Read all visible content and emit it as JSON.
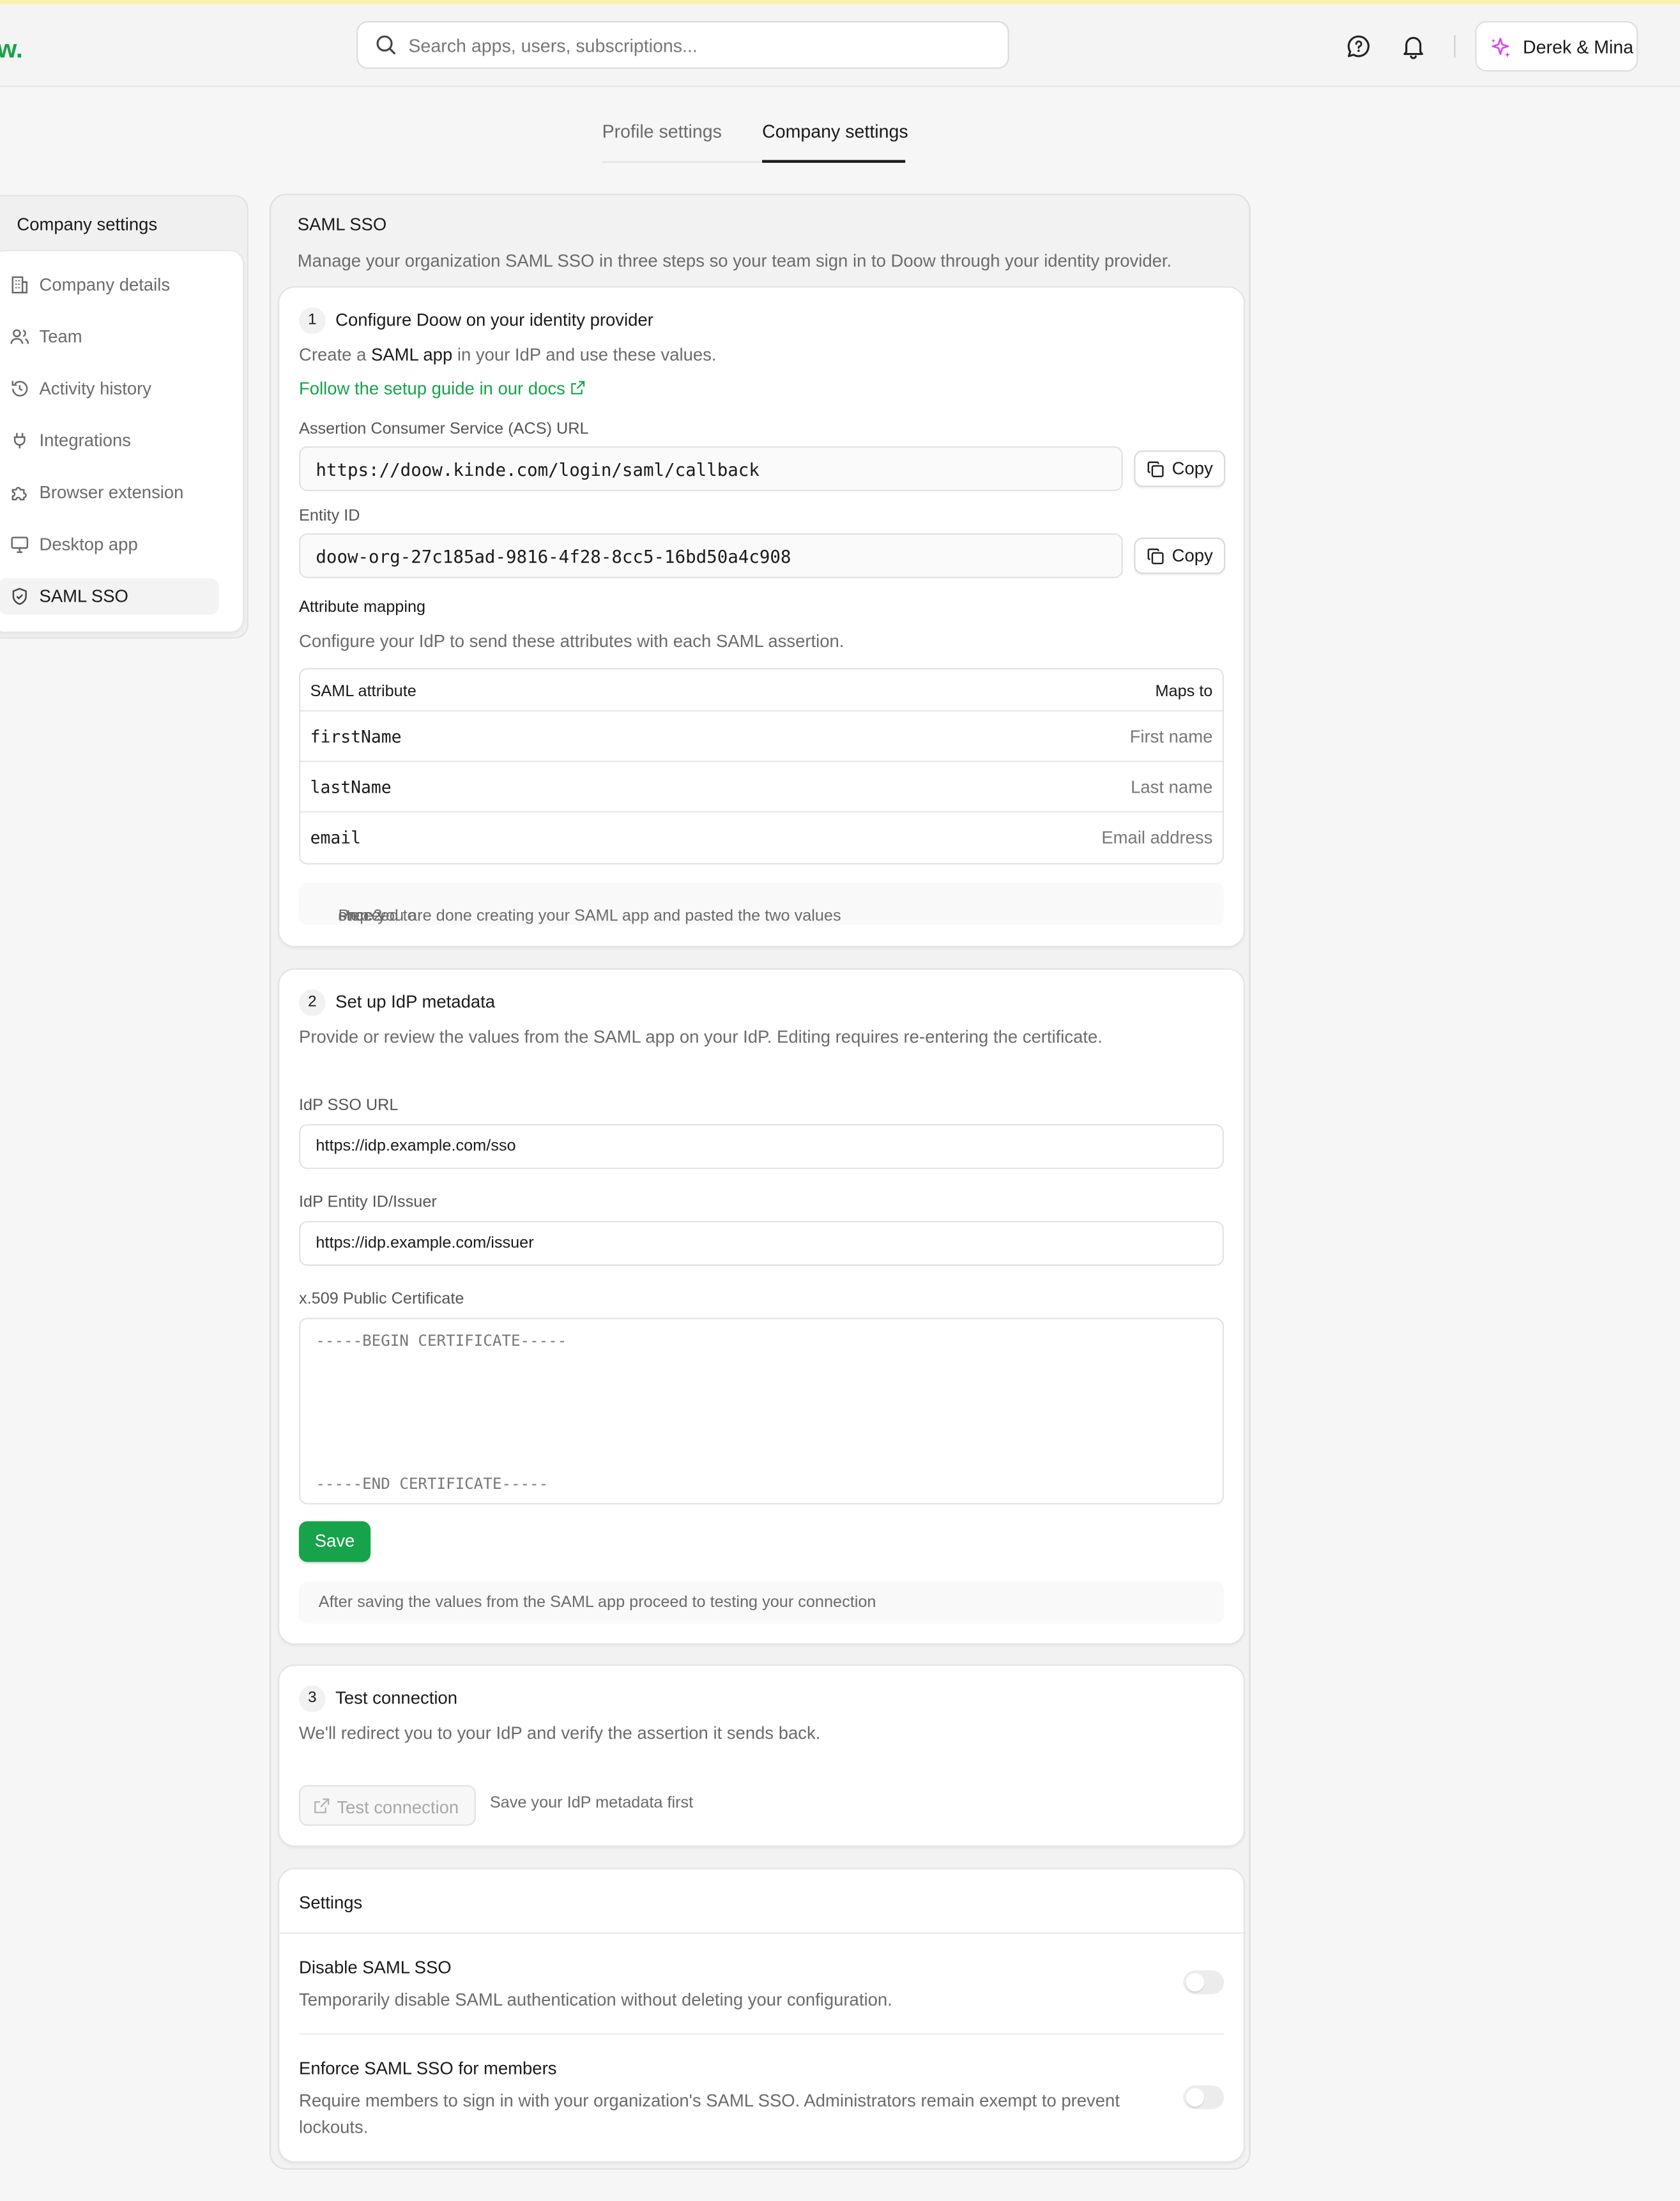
{
  "brand": {
    "logo_text": "w.",
    "accent": "#16a34a"
  },
  "search": {
    "placeholder": "Search apps, users, subscriptions..."
  },
  "user": {
    "name": "Derek & Mina"
  },
  "tabs": [
    {
      "label": "Profile settings",
      "active": false
    },
    {
      "label": "Company settings",
      "active": true
    }
  ],
  "sidebar": {
    "title": "Company settings",
    "items": [
      {
        "label": "Company details",
        "icon": "building-icon"
      },
      {
        "label": "Team",
        "icon": "users-icon"
      },
      {
        "label": "Activity history",
        "icon": "history-icon"
      },
      {
        "label": "Integrations",
        "icon": "plug-icon"
      },
      {
        "label": "Browser extension",
        "icon": "puzzle-icon"
      },
      {
        "label": "Desktop app",
        "icon": "monitor-icon"
      },
      {
        "label": "SAML SSO",
        "icon": "shield-icon",
        "active": true
      }
    ]
  },
  "panel": {
    "title": "SAML SSO",
    "description": "Manage your organization SAML SSO in three steps so your team sign in to Doow through your identity provider."
  },
  "step1": {
    "number": "1",
    "title": "Configure Doow on your identity provider",
    "desc_prefix": "Create a ",
    "desc_bold": "SAML app",
    "desc_suffix": " in your IdP and use these values.",
    "link": "Follow the setup guide in our docs",
    "acs_label": "Assertion Consumer Service (ACS) URL",
    "acs_value": "https://doow.kinde.com/login/saml/callback",
    "entity_label": "Entity ID",
    "entity_value": "doow-org-27c185ad-9816-4f28-8cc5-16bd50a4c908",
    "copy_label": "Copy",
    "mapping_title": "Attribute mapping",
    "mapping_desc": "Configure your IdP to send these attributes with each SAML assertion.",
    "mapping_headers": {
      "attr": "SAML attribute",
      "maps": "Maps to"
    },
    "mapping_rows": [
      {
        "attr": "firstName",
        "maps": "First name"
      },
      {
        "attr": "lastName",
        "maps": "Last name"
      },
      {
        "attr": "email",
        "maps": "Email address"
      }
    ],
    "note_prefix": "Proceed to ",
    "note_bold": "step 2",
    "note_suffix": " once you are done creating your SAML app and pasted the two values"
  },
  "step2": {
    "number": "2",
    "title": "Set up IdP metadata",
    "desc": "Provide or review the values from the SAML app on your IdP. Editing requires re-entering the certificate.",
    "sso_url_label": "IdP SSO URL",
    "sso_url_value": "https://idp.example.com/sso",
    "issuer_label": "IdP Entity ID/Issuer",
    "issuer_value": "https://idp.example.com/issuer",
    "cert_label": "x.509 Public Certificate",
    "cert_begin": "-----BEGIN CERTIFICATE-----",
    "cert_end": "-----END CERTIFICATE-----",
    "save_label": "Save",
    "note": "After saving the values from the SAML app proceed to testing your connection"
  },
  "step3": {
    "number": "3",
    "title": "Test connection",
    "desc": "We'll redirect you to your IdP and verify the assertion it sends back.",
    "button_label": "Test connection",
    "hint": "Save your IdP metadata first"
  },
  "settings": {
    "title": "Settings",
    "disable_title": "Disable SAML SSO",
    "disable_desc": "Temporarily disable SAML authentication without deleting your configuration.",
    "disable_on": false,
    "enforce_title": "Enforce SAML SSO for members",
    "enforce_desc_line1": "Require members to sign in with your organization's SAML SSO. Administrators remain exempt to prevent",
    "enforce_desc_line2": "lockouts.",
    "enforce_on": false
  }
}
